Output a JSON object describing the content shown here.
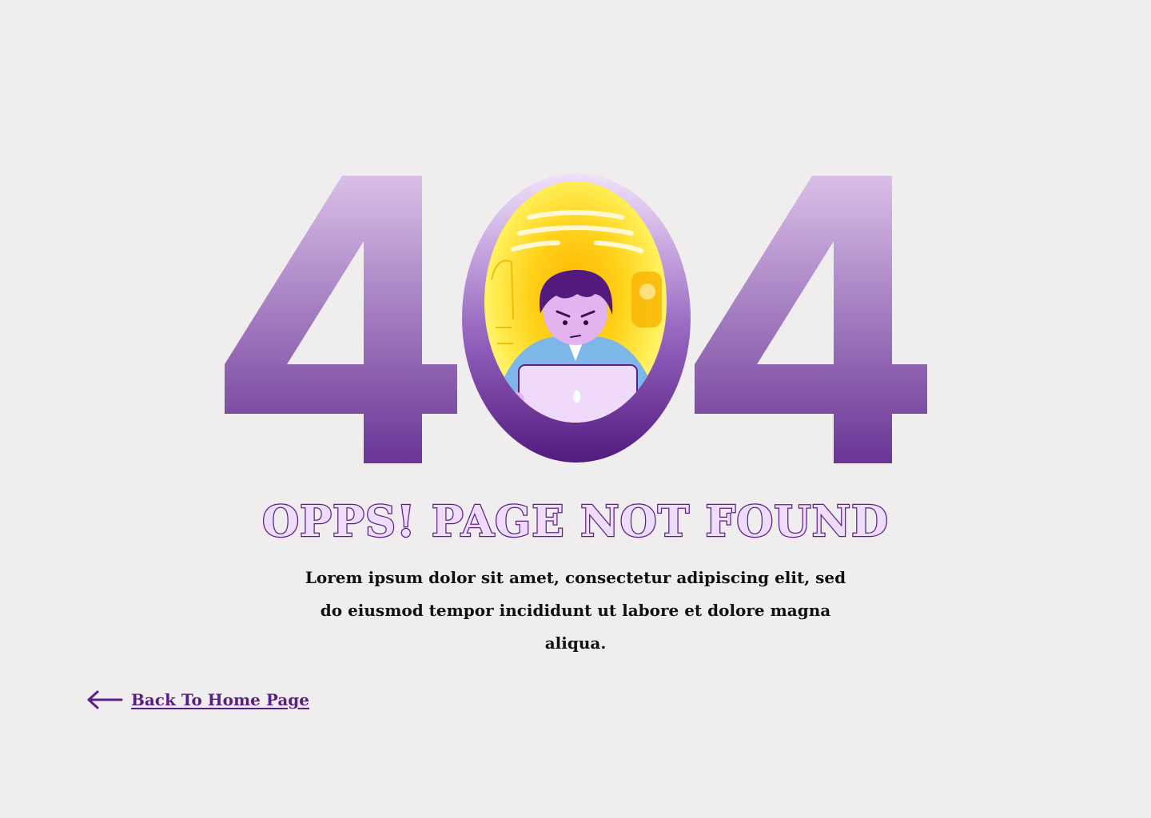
{
  "hero": {
    "digit_left": "4",
    "digit_right": "4",
    "illustration": "person-frowning-at-laptop-illustration"
  },
  "title": "OPPS! PAGE NOT FOUND",
  "description": "Lorem ipsum dolor sit amet, consectetur adipiscing elit, sed do eiusmod tempor incididunt ut labore et dolore magna aliqua.",
  "back_link": {
    "label": "Back To Home Page",
    "icon": "arrow-left-icon"
  },
  "colors": {
    "background": "#f0edee",
    "accent": "#5a1f87",
    "digit_gradient_top": "#d9bfe8",
    "digit_gradient_bottom": "#6a3596",
    "title_fill": "#efdcfb"
  }
}
